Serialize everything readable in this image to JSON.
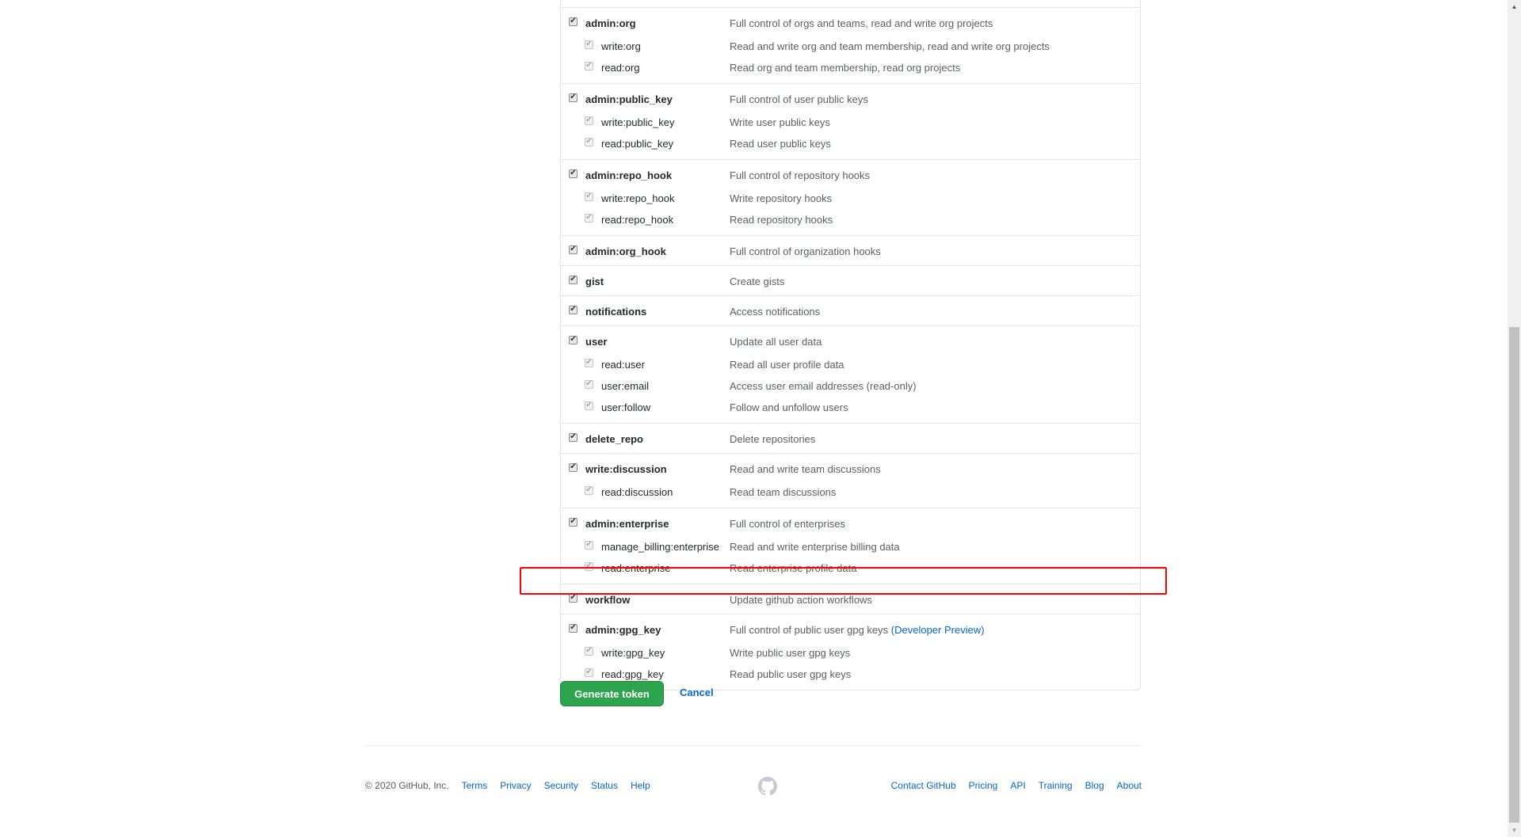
{
  "scopes": [
    {
      "name": "admin:org",
      "description": "Full control of orgs and teams, read and write org projects",
      "checked": true,
      "children": [
        {
          "name": "write:org",
          "description": "Read and write org and team membership, read and write org projects",
          "checked": true
        },
        {
          "name": "read:org",
          "description": "Read org and team membership, read org projects",
          "checked": true
        }
      ]
    },
    {
      "name": "admin:public_key",
      "description": "Full control of user public keys",
      "checked": true,
      "children": [
        {
          "name": "write:public_key",
          "description": "Write user public keys",
          "checked": true
        },
        {
          "name": "read:public_key",
          "description": "Read user public keys",
          "checked": true
        }
      ]
    },
    {
      "name": "admin:repo_hook",
      "description": "Full control of repository hooks",
      "checked": true,
      "children": [
        {
          "name": "write:repo_hook",
          "description": "Write repository hooks",
          "checked": true
        },
        {
          "name": "read:repo_hook",
          "description": "Read repository hooks",
          "checked": true
        }
      ]
    },
    {
      "name": "admin:org_hook",
      "description": "Full control of organization hooks",
      "checked": true,
      "children": []
    },
    {
      "name": "gist",
      "description": "Create gists",
      "checked": true,
      "children": []
    },
    {
      "name": "notifications",
      "description": "Access notifications",
      "checked": true,
      "children": []
    },
    {
      "name": "user",
      "description": "Update all user data",
      "checked": true,
      "children": [
        {
          "name": "read:user",
          "description": "Read all user profile data",
          "checked": true
        },
        {
          "name": "user:email",
          "description": "Access user email addresses (read-only)",
          "checked": true
        },
        {
          "name": "user:follow",
          "description": "Follow and unfollow users",
          "checked": true
        }
      ]
    },
    {
      "name": "delete_repo",
      "description": "Delete repositories",
      "checked": true,
      "children": []
    },
    {
      "name": "write:discussion",
      "description": "Read and write team discussions",
      "checked": true,
      "children": [
        {
          "name": "read:discussion",
          "description": "Read team discussions",
          "checked": true
        }
      ]
    },
    {
      "name": "admin:enterprise",
      "description": "Full control of enterprises",
      "checked": true,
      "children": [
        {
          "name": "manage_billing:enterprise",
          "description": "Read and write enterprise billing data",
          "checked": true
        },
        {
          "name": "read:enterprise",
          "description": "Read enterprise profile data",
          "checked": true
        }
      ]
    },
    {
      "name": "workflow",
      "description": "Update github action workflows",
      "checked": true,
      "highlighted": true,
      "children": []
    },
    {
      "name": "admin:gpg_key",
      "description": "Full control of public user gpg keys",
      "link": "(Developer Preview)",
      "checked": true,
      "children": [
        {
          "name": "write:gpg_key",
          "description": "Write public user gpg keys",
          "checked": true
        },
        {
          "name": "read:gpg_key",
          "description": "Read public user gpg keys",
          "checked": true
        }
      ]
    }
  ],
  "actions": {
    "generate_label": "Generate token",
    "cancel_label": "Cancel"
  },
  "footer": {
    "copyright": "© 2020 GitHub, Inc.",
    "left_links": [
      "Terms",
      "Privacy",
      "Security",
      "Status",
      "Help"
    ],
    "right_links": [
      "Contact GitHub",
      "Pricing",
      "API",
      "Training",
      "Blog",
      "About"
    ],
    "logo_icon": "github-octocat-icon"
  },
  "colors": {
    "primary_button": "#2ea44f",
    "link": "#0366d6",
    "highlight_box": "#ff0000"
  }
}
